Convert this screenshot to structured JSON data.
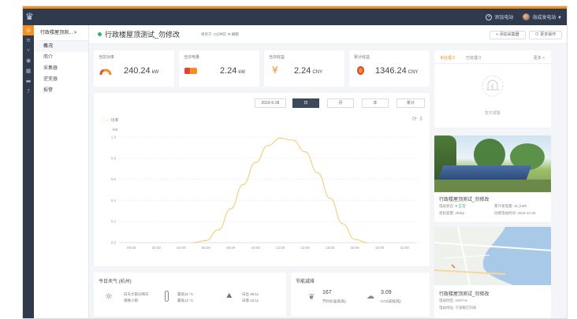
{
  "topbar": {
    "add_station": "添加电站",
    "user": "海成发电站 ▼"
  },
  "subnav": {
    "station_title": "行政楼屋顶测...",
    "items": [
      "概况",
      "简介",
      "采集器",
      "逆变器",
      "报警"
    ]
  },
  "page": {
    "title": "行政楼屋顶测试_勿修改",
    "update_text": "更新于: 2分钟前",
    "refresh": "刷新",
    "add_collector": "+ 添加采集器",
    "more_ops": "更多操作"
  },
  "stats": [
    {
      "label": "当前功率",
      "value": "240.24",
      "unit": "kW",
      "icon": "gauge-icon"
    },
    {
      "label": "当日电量",
      "value": "2.24",
      "unit": "kW",
      "icon": "battery-icon"
    },
    {
      "label": "当日收益",
      "value": "2.24",
      "unit": "CNY",
      "icon": "yuan-icon"
    },
    {
      "label": "累计收益",
      "value": "1346.24",
      "unit": "CNY",
      "icon": "coin-icon"
    }
  ],
  "chart_controls": {
    "date": "2019-5-28",
    "day": "日",
    "month": "月",
    "year": "年",
    "total": "累计"
  },
  "chart_data": {
    "type": "line",
    "legend": "功率",
    "ylabel": "kW",
    "ylim": [
      0,
      1.0
    ],
    "yticks": [
      "0.0",
      "0.2",
      "0.4",
      "0.6",
      "0.8",
      "1.0"
    ],
    "xticks": [
      "00:00",
      "02:00",
      "04:00",
      "06:00",
      "08:00",
      "10:00",
      "12:00",
      "14:00",
      "16:00",
      "18:00",
      "20:00",
      "22:00"
    ],
    "x": [
      5,
      6,
      7,
      8,
      9,
      10,
      11,
      12,
      13,
      14,
      15,
      16,
      17,
      18,
      19
    ],
    "values": [
      0.0,
      0.02,
      0.12,
      0.32,
      0.55,
      0.76,
      0.92,
      0.99,
      0.97,
      0.86,
      0.66,
      0.42,
      0.18,
      0.03,
      0.0
    ]
  },
  "alerts": {
    "tab_unresolved": "未处理 0",
    "tab_resolved": "已处理 0",
    "more": "更多 >",
    "empty": "暂无报警"
  },
  "station": {
    "name": "行政楼屋顶测试_勿修改",
    "status_label": "电站状态:",
    "status_value": "● 正常",
    "total_power_label": "累计发电量:",
    "total_power_value": "1k_kWh",
    "capacity_label": "装机容量:",
    "capacity_value": "2kWp",
    "created_label": "创建电站时间:",
    "created_value": "2018-12-20"
  },
  "map_station": {
    "name": "行政楼屋顶测试_勿修改",
    "tz_label": "电站时区:",
    "tz_value": "GMT+8",
    "addr_label": "电站地址:",
    "addr_value": "宁波银亿科技"
  },
  "weather": {
    "title": "今日天气 (杭州)",
    "desc": "白天大部分晴天",
    "night": "夜晚小雨",
    "high": "最高32 °C",
    "low": "最低12 °C",
    "sunrise": "日出 05:11",
    "sunset": "日落 15:11"
  },
  "savings": {
    "title": "节能减排",
    "coal_value": "167",
    "coal_label": "节约标准煤(吨)",
    "co2_value": "3.09",
    "co2_label": "CO2减排(吨)"
  },
  "colors": {
    "accent": "#f29024",
    "nav_dark": "#2f3a4d",
    "line": "#f2c96b",
    "ok": "#34b36b"
  }
}
